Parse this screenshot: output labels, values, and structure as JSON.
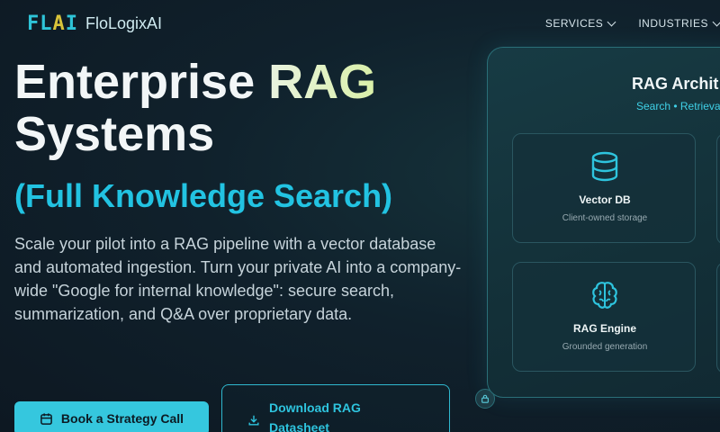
{
  "header": {
    "logo_mark_a": "FL",
    "logo_mark_b": "A",
    "logo_mark_c": "I",
    "logo_text": "FloLogixAI",
    "nav": [
      {
        "label": "SERVICES"
      },
      {
        "label": "INDUSTRIES"
      }
    ]
  },
  "hero": {
    "title_line1_a": "Enterprise ",
    "title_line1_b": "RAG",
    "title_line2": "Systems",
    "subtitle": "(Full Knowledge Search)",
    "description": "Scale your pilot into a RAG pipeline with a vector database and automated ingestion. Turn your private AI into a company-wide \"Google for internal knowledge\": secure search, summarization, and Q&A over proprietary data.",
    "primary_cta": "Book a Strategy Call",
    "secondary_cta": "Download RAG Datasheet"
  },
  "panel": {
    "title": "RAG Archit",
    "subtitle": "Search • Retrieva",
    "cards": [
      {
        "title": "Vector DB",
        "subtitle": "Client-owned storage",
        "icon": "database-icon"
      },
      {
        "title": "RAG Engine",
        "subtitle": "Grounded generation",
        "icon": "brain-icon"
      }
    ]
  },
  "colors": {
    "accent": "#35c7de",
    "background": "#0f1c27",
    "subtitle": "#22c3e2"
  }
}
